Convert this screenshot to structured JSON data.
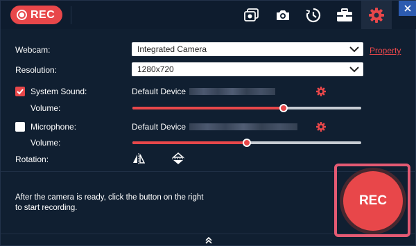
{
  "app": {
    "rec_logo_label": "REC"
  },
  "toolbar": {
    "items": [
      {
        "icon": "gallery-icon"
      },
      {
        "icon": "camera-icon"
      },
      {
        "icon": "clock-icon"
      },
      {
        "icon": "toolbox-icon"
      },
      {
        "icon": "gear-icon"
      }
    ]
  },
  "form": {
    "webcam_label": "Webcam:",
    "webcam_value": "Integrated Camera",
    "property_link": "Property",
    "resolution_label": "Resolution:",
    "resolution_value": "1280x720",
    "system_sound_label": "System Sound:",
    "system_sound_checked": true,
    "system_sound_device": "Default Device",
    "system_volume_label": "Volume:",
    "system_volume_level": 0.66,
    "microphone_label": "Microphone:",
    "microphone_checked": false,
    "microphone_device": "Default Device",
    "mic_volume_label": "Volume:",
    "mic_volume_level": 0.5,
    "rotation_label": "Rotation:"
  },
  "footer": {
    "hint": "After the camera is ready, click the button on the right to start recording.",
    "rec_button": "REC"
  },
  "colors": {
    "accent": "#e8474a",
    "background": "#101f31",
    "highlight_frame": "#e45a73"
  }
}
